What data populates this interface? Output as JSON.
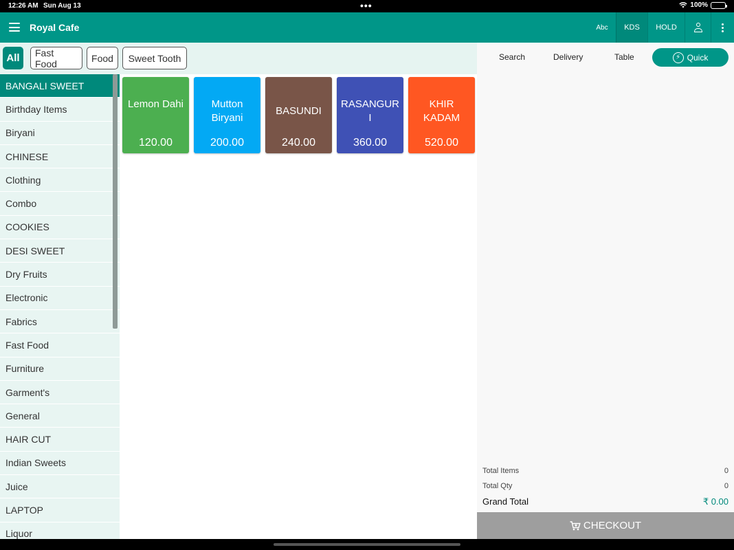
{
  "status": {
    "time": "12:26 AM",
    "date": "Sun Aug 13",
    "battery": "100%"
  },
  "appbar": {
    "title": "Royal Cafe",
    "actions": {
      "abc": "Abc",
      "kds": "KDS",
      "hold": "HOLD"
    }
  },
  "chips": [
    "All",
    "Fast Food",
    "Food",
    "Sweet Tooth"
  ],
  "categories": [
    "BANGALI SWEET",
    "Birthday Items",
    "Biryani",
    "CHINESE",
    "Clothing",
    "Combo",
    "COOKIES",
    "DESI SWEET",
    "Dry Fruits",
    "Electronic",
    "Fabrics",
    "Fast Food",
    "Furniture",
    "Garment's",
    "General",
    "HAIR CUT",
    "Indian Sweets",
    "Juice",
    "LAPTOP",
    "Liquor"
  ],
  "products": [
    {
      "name": "Lemon Dahi",
      "price": "120.00",
      "color": "#4caf50"
    },
    {
      "name": "Mutton Biryani",
      "price": "200.00",
      "color": "#03a9f4"
    },
    {
      "name": "BASUNDI",
      "price": "240.00",
      "color": "#795548"
    },
    {
      "name": "RASANGURI",
      "price": "360.00",
      "color": "#3f51b5"
    },
    {
      "name": "KHIR KADAM",
      "price": "520.00",
      "color": "#ff5722"
    }
  ],
  "order": {
    "tabs": {
      "search": "Search",
      "delivery": "Delivery",
      "table": "Table",
      "quick": "Quick"
    },
    "total_items_label": "Total Items",
    "total_items": "0",
    "total_qty_label": "Total Qty",
    "total_qty": "0",
    "grand_total_label": "Grand Total",
    "grand_total": "₹ 0.00",
    "checkout": "CHECKOUT"
  },
  "colors": {
    "primary": "#009688",
    "primary_dark": "#00897b",
    "checkout_disabled": "#9e9e9e"
  },
  "icons": {
    "menu": "menu-icon",
    "user": "user-icon",
    "more": "more-vert-icon",
    "quick": "bolt-icon",
    "cart": "cart-icon",
    "wifi": "wifi-icon",
    "battery": "battery-icon"
  }
}
